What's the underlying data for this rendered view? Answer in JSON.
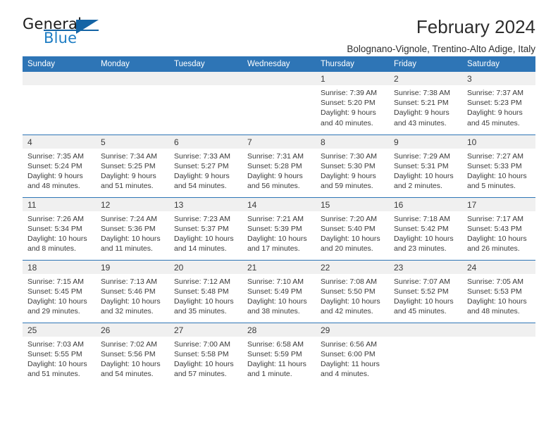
{
  "brand": {
    "word1": "General",
    "word2": "Blue",
    "accent_color": "#1464a5",
    "triangle_icon": "triangle-icon"
  },
  "header": {
    "title": "February 2024",
    "location": "Bolognano-Vignole, Trentino-Alto Adige, Italy"
  },
  "calendar": {
    "header_color": "#2e75b6",
    "weekday_headers": [
      "Sunday",
      "Monday",
      "Tuesday",
      "Wednesday",
      "Thursday",
      "Friday",
      "Saturday"
    ],
    "weeks": [
      [
        {
          "day": "",
          "blank": true,
          "sunrise": "",
          "sunset": "",
          "daylight1": "",
          "daylight2": ""
        },
        {
          "day": "",
          "blank": true,
          "sunrise": "",
          "sunset": "",
          "daylight1": "",
          "daylight2": ""
        },
        {
          "day": "",
          "blank": true,
          "sunrise": "",
          "sunset": "",
          "daylight1": "",
          "daylight2": ""
        },
        {
          "day": "",
          "blank": true,
          "sunrise": "",
          "sunset": "",
          "daylight1": "",
          "daylight2": ""
        },
        {
          "day": "1",
          "blank": false,
          "sunrise": "Sunrise: 7:39 AM",
          "sunset": "Sunset: 5:20 PM",
          "daylight1": "Daylight: 9 hours",
          "daylight2": "and 40 minutes."
        },
        {
          "day": "2",
          "blank": false,
          "sunrise": "Sunrise: 7:38 AM",
          "sunset": "Sunset: 5:21 PM",
          "daylight1": "Daylight: 9 hours",
          "daylight2": "and 43 minutes."
        },
        {
          "day": "3",
          "blank": false,
          "sunrise": "Sunrise: 7:37 AM",
          "sunset": "Sunset: 5:23 PM",
          "daylight1": "Daylight: 9 hours",
          "daylight2": "and 45 minutes."
        }
      ],
      [
        {
          "day": "4",
          "blank": false,
          "sunrise": "Sunrise: 7:35 AM",
          "sunset": "Sunset: 5:24 PM",
          "daylight1": "Daylight: 9 hours",
          "daylight2": "and 48 minutes."
        },
        {
          "day": "5",
          "blank": false,
          "sunrise": "Sunrise: 7:34 AM",
          "sunset": "Sunset: 5:25 PM",
          "daylight1": "Daylight: 9 hours",
          "daylight2": "and 51 minutes."
        },
        {
          "day": "6",
          "blank": false,
          "sunrise": "Sunrise: 7:33 AM",
          "sunset": "Sunset: 5:27 PM",
          "daylight1": "Daylight: 9 hours",
          "daylight2": "and 54 minutes."
        },
        {
          "day": "7",
          "blank": false,
          "sunrise": "Sunrise: 7:31 AM",
          "sunset": "Sunset: 5:28 PM",
          "daylight1": "Daylight: 9 hours",
          "daylight2": "and 56 minutes."
        },
        {
          "day": "8",
          "blank": false,
          "sunrise": "Sunrise: 7:30 AM",
          "sunset": "Sunset: 5:30 PM",
          "daylight1": "Daylight: 9 hours",
          "daylight2": "and 59 minutes."
        },
        {
          "day": "9",
          "blank": false,
          "sunrise": "Sunrise: 7:29 AM",
          "sunset": "Sunset: 5:31 PM",
          "daylight1": "Daylight: 10 hours",
          "daylight2": "and 2 minutes."
        },
        {
          "day": "10",
          "blank": false,
          "sunrise": "Sunrise: 7:27 AM",
          "sunset": "Sunset: 5:33 PM",
          "daylight1": "Daylight: 10 hours",
          "daylight2": "and 5 minutes."
        }
      ],
      [
        {
          "day": "11",
          "blank": false,
          "sunrise": "Sunrise: 7:26 AM",
          "sunset": "Sunset: 5:34 PM",
          "daylight1": "Daylight: 10 hours",
          "daylight2": "and 8 minutes."
        },
        {
          "day": "12",
          "blank": false,
          "sunrise": "Sunrise: 7:24 AM",
          "sunset": "Sunset: 5:36 PM",
          "daylight1": "Daylight: 10 hours",
          "daylight2": "and 11 minutes."
        },
        {
          "day": "13",
          "blank": false,
          "sunrise": "Sunrise: 7:23 AM",
          "sunset": "Sunset: 5:37 PM",
          "daylight1": "Daylight: 10 hours",
          "daylight2": "and 14 minutes."
        },
        {
          "day": "14",
          "blank": false,
          "sunrise": "Sunrise: 7:21 AM",
          "sunset": "Sunset: 5:39 PM",
          "daylight1": "Daylight: 10 hours",
          "daylight2": "and 17 minutes."
        },
        {
          "day": "15",
          "blank": false,
          "sunrise": "Sunrise: 7:20 AM",
          "sunset": "Sunset: 5:40 PM",
          "daylight1": "Daylight: 10 hours",
          "daylight2": "and 20 minutes."
        },
        {
          "day": "16",
          "blank": false,
          "sunrise": "Sunrise: 7:18 AM",
          "sunset": "Sunset: 5:42 PM",
          "daylight1": "Daylight: 10 hours",
          "daylight2": "and 23 minutes."
        },
        {
          "day": "17",
          "blank": false,
          "sunrise": "Sunrise: 7:17 AM",
          "sunset": "Sunset: 5:43 PM",
          "daylight1": "Daylight: 10 hours",
          "daylight2": "and 26 minutes."
        }
      ],
      [
        {
          "day": "18",
          "blank": false,
          "sunrise": "Sunrise: 7:15 AM",
          "sunset": "Sunset: 5:45 PM",
          "daylight1": "Daylight: 10 hours",
          "daylight2": "and 29 minutes."
        },
        {
          "day": "19",
          "blank": false,
          "sunrise": "Sunrise: 7:13 AM",
          "sunset": "Sunset: 5:46 PM",
          "daylight1": "Daylight: 10 hours",
          "daylight2": "and 32 minutes."
        },
        {
          "day": "20",
          "blank": false,
          "sunrise": "Sunrise: 7:12 AM",
          "sunset": "Sunset: 5:48 PM",
          "daylight1": "Daylight: 10 hours",
          "daylight2": "and 35 minutes."
        },
        {
          "day": "21",
          "blank": false,
          "sunrise": "Sunrise: 7:10 AM",
          "sunset": "Sunset: 5:49 PM",
          "daylight1": "Daylight: 10 hours",
          "daylight2": "and 38 minutes."
        },
        {
          "day": "22",
          "blank": false,
          "sunrise": "Sunrise: 7:08 AM",
          "sunset": "Sunset: 5:50 PM",
          "daylight1": "Daylight: 10 hours",
          "daylight2": "and 42 minutes."
        },
        {
          "day": "23",
          "blank": false,
          "sunrise": "Sunrise: 7:07 AM",
          "sunset": "Sunset: 5:52 PM",
          "daylight1": "Daylight: 10 hours",
          "daylight2": "and 45 minutes."
        },
        {
          "day": "24",
          "blank": false,
          "sunrise": "Sunrise: 7:05 AM",
          "sunset": "Sunset: 5:53 PM",
          "daylight1": "Daylight: 10 hours",
          "daylight2": "and 48 minutes."
        }
      ],
      [
        {
          "day": "25",
          "blank": false,
          "sunrise": "Sunrise: 7:03 AM",
          "sunset": "Sunset: 5:55 PM",
          "daylight1": "Daylight: 10 hours",
          "daylight2": "and 51 minutes."
        },
        {
          "day": "26",
          "blank": false,
          "sunrise": "Sunrise: 7:02 AM",
          "sunset": "Sunset: 5:56 PM",
          "daylight1": "Daylight: 10 hours",
          "daylight2": "and 54 minutes."
        },
        {
          "day": "27",
          "blank": false,
          "sunrise": "Sunrise: 7:00 AM",
          "sunset": "Sunset: 5:58 PM",
          "daylight1": "Daylight: 10 hours",
          "daylight2": "and 57 minutes."
        },
        {
          "day": "28",
          "blank": false,
          "sunrise": "Sunrise: 6:58 AM",
          "sunset": "Sunset: 5:59 PM",
          "daylight1": "Daylight: 11 hours",
          "daylight2": "and 1 minute."
        },
        {
          "day": "29",
          "blank": false,
          "sunrise": "Sunrise: 6:56 AM",
          "sunset": "Sunset: 6:00 PM",
          "daylight1": "Daylight: 11 hours",
          "daylight2": "and 4 minutes."
        },
        {
          "day": "",
          "blank": true,
          "sunrise": "",
          "sunset": "",
          "daylight1": "",
          "daylight2": ""
        },
        {
          "day": "",
          "blank": true,
          "sunrise": "",
          "sunset": "",
          "daylight1": "",
          "daylight2": ""
        }
      ]
    ]
  }
}
